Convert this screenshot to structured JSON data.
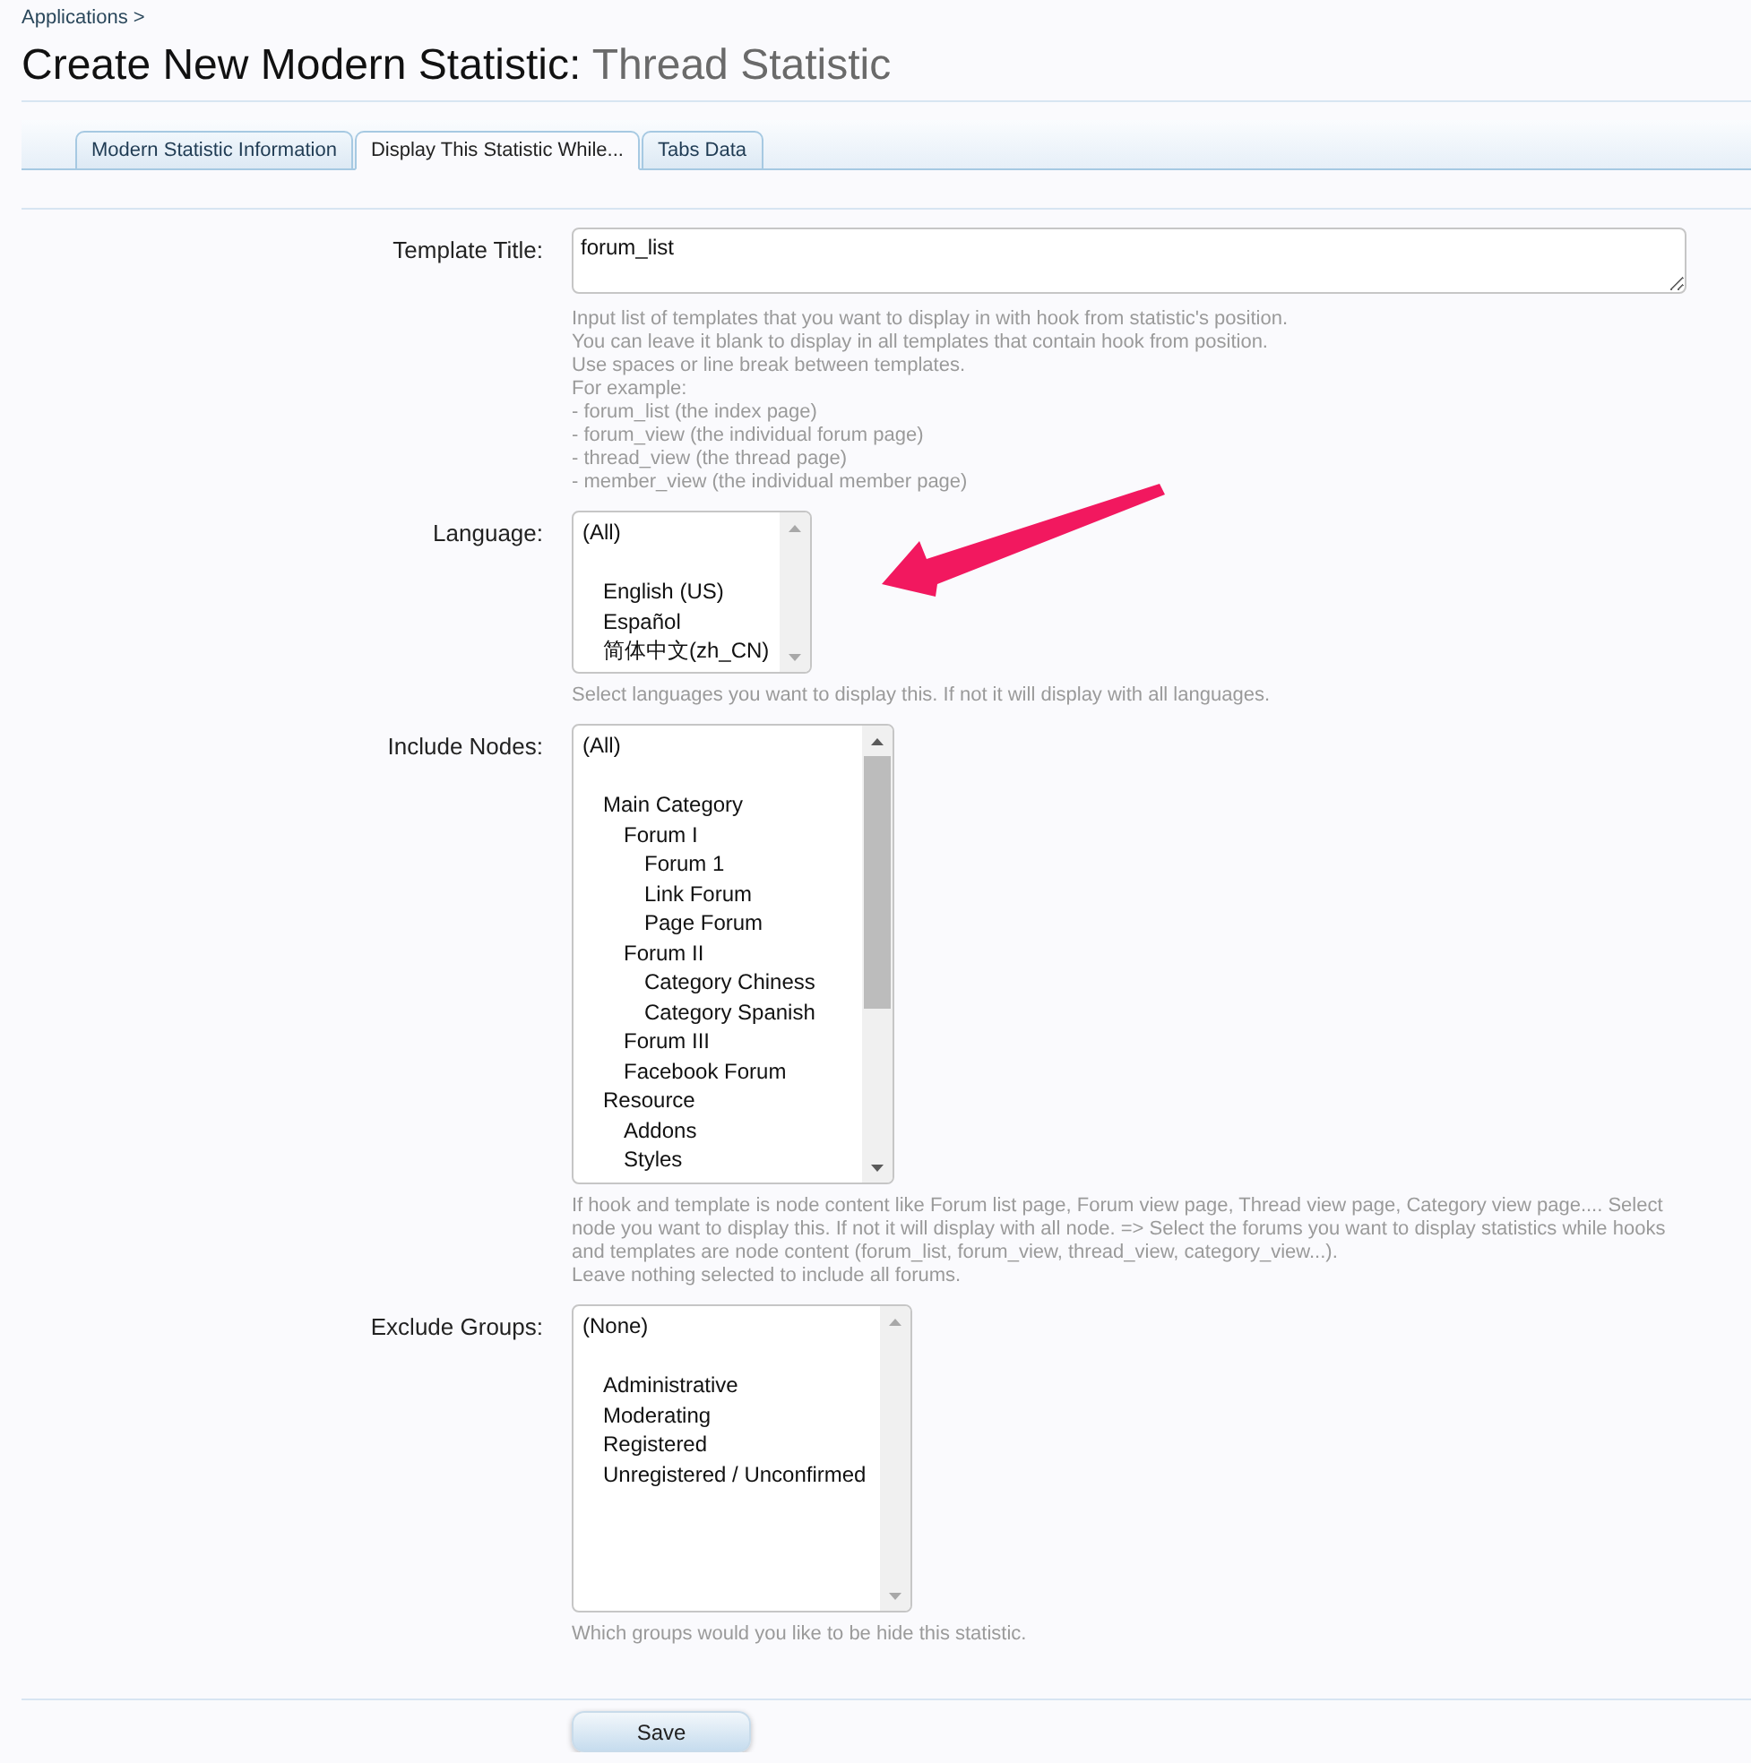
{
  "breadcrumb": [
    {
      "label": "Applications >"
    }
  ],
  "title": {
    "text": "Create New Modern Statistic:",
    "subject": "Thread Statistic"
  },
  "tabs": [
    {
      "label": "Modern Statistic Information",
      "selected": false
    },
    {
      "label": "Display This Statistic While...",
      "selected": true
    },
    {
      "label": "Tabs Data",
      "selected": false
    }
  ],
  "fields": [
    {
      "kind": "textarea",
      "label": "Template Title:",
      "value": "forum_list",
      "hint": "Input list of templates that you want to display in with hook from statistic's position.\nYou can leave it blank to display in all templates that contain hook from position.\nUse spaces or line break between templates.\nFor example:\n- forum_list (the index page)\n- forum_view (the individual forum page)\n- thread_view (the thread page)\n- member_view (the individual member page)"
    },
    {
      "kind": "listbox",
      "label": "Language:",
      "annotation_arrow": true,
      "overflow": false,
      "options": [
        {
          "label": "(All)",
          "selected": false
        }
      ],
      "items": [
        {
          "label": "English (US)",
          "selected": false
        },
        {
          "label": "Español",
          "selected": false
        },
        {
          "label": "简体中文(zh_CN)",
          "selected": false
        }
      ],
      "hint": "Select languages you want to display this. If not it will display with all languages."
    },
    {
      "kind": "listbox",
      "label": "Include Nodes:",
      "overflow": true,
      "options": [
        {
          "label": "(All)",
          "selected": false
        }
      ],
      "items": [
        {
          "label": "Main Category",
          "selected": false,
          "children": [
            {
              "label": "Forum I",
              "selected": false,
              "children": [
                {
                  "label": "Forum 1",
                  "selected": false
                },
                {
                  "label": "Link Forum",
                  "selected": false
                },
                {
                  "label": "Page Forum",
                  "selected": false
                }
              ]
            },
            {
              "label": "Forum II",
              "selected": false,
              "children": [
                {
                  "label": "Category Chiness",
                  "selected": false
                },
                {
                  "label": "Category Spanish",
                  "selected": false
                }
              ]
            },
            {
              "label": "Forum III",
              "selected": false
            },
            {
              "label": "Facebook Forum",
              "selected": false
            }
          ]
        },
        {
          "label": "Resource",
          "selected": false,
          "children": [
            {
              "label": "Addons",
              "selected": false
            },
            {
              "label": "Styles",
              "selected": false
            }
          ]
        }
      ],
      "hint": "If hook and template is node content like Forum list page, Forum view page, Thread view page, Category view page.... Select node you want to display this. If not it will display with all node. => Select the forums you want to display statistics while hooks and templates are node content (forum_list, forum_view, thread_view, category_view...).\nLeave nothing selected to include all forums."
    },
    {
      "kind": "listbox",
      "label": "Exclude Groups:",
      "overflow": false,
      "options": [
        {
          "label": "(None)",
          "selected": false
        }
      ],
      "items": [
        {
          "label": "Administrative",
          "selected": false
        },
        {
          "label": "Moderating",
          "selected": false
        },
        {
          "label": "Registered",
          "selected": false
        },
        {
          "label": "Unregistered / Unconfirmed",
          "selected": false
        }
      ],
      "hint": "Which groups would you like to be hide this statistic."
    }
  ],
  "buttons": [
    {
      "label": "Save"
    }
  ]
}
